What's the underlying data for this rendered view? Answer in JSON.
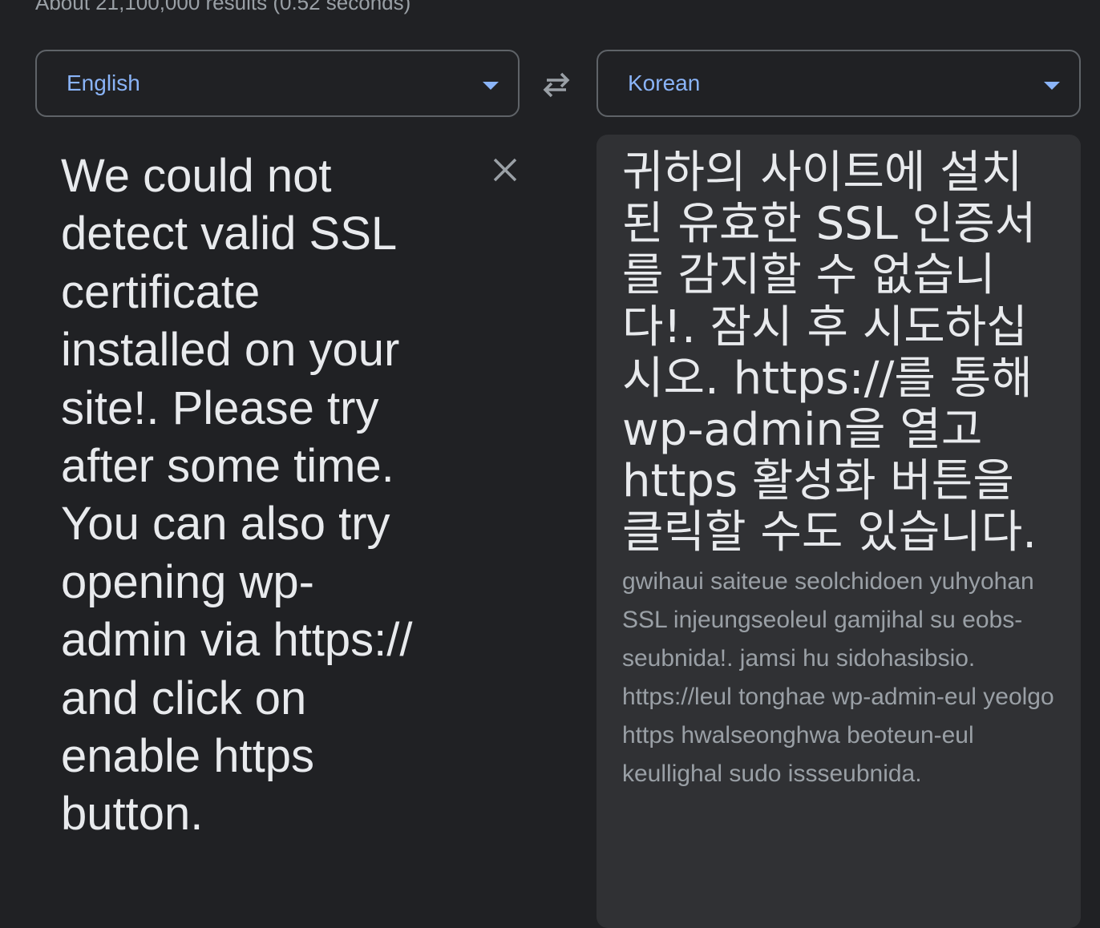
{
  "results_stats": "About 21,100,000 results (0.52 seconds)",
  "source": {
    "language": "English",
    "text": "We could not detect valid SSL certificate installed on your site!. Please try after some time. You can also try opening wp-admin via https:// and click on enable https button."
  },
  "target": {
    "language": "Korean",
    "text": "귀하의 사이트에 설치된 유효한 SSL 인증서를 감지할 수 없습니다!. 잠시 후 시도하십시오. https://를 통해 wp-admin을 열고 https 활성화 버튼을 클릭할 수도 있습니다.",
    "romanization": "gwihaui saiteue seolchidoen yuhyohan SSL injeungseoleul gamjihal su eobs-seubnida!. jamsi hu sidohasibsio. https://leul tonghae wp-admin-eul yeolgo https hwalseonghwa beoteun-eul keullighal sudo issseubnida."
  },
  "icons": {
    "swap": "swap-languages-icon",
    "clear": "close-icon",
    "dropdown": "chevron-down-icon"
  },
  "colors": {
    "background": "#202124",
    "accent": "#8ab4f8",
    "text": "#e8eaed",
    "muted": "#9aa0a6",
    "border": "#5f6368",
    "target_panel": "#303134"
  }
}
